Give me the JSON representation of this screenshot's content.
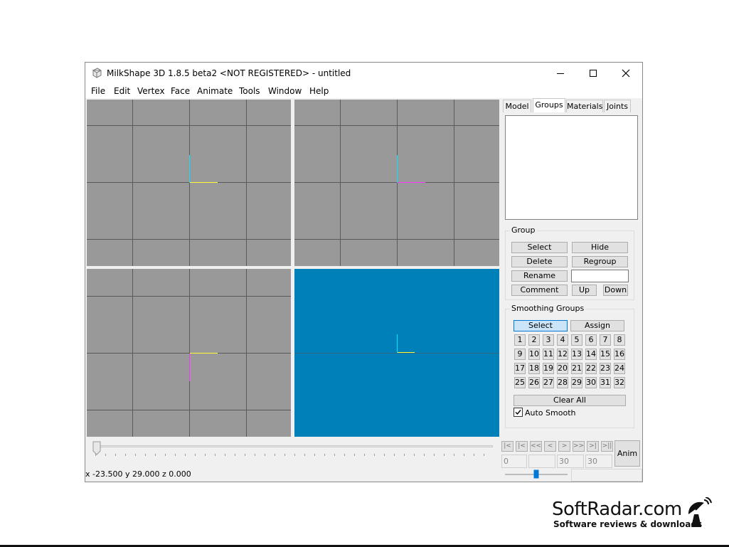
{
  "window": {
    "title": "MilkShape 3D 1.8.5 beta2 <NOT REGISTERED> - untitled"
  },
  "menu": [
    "File",
    "Edit",
    "Vertex",
    "Face",
    "Animate",
    "Tools",
    "Window",
    "Help"
  ],
  "tabs": [
    {
      "label": "Model",
      "active": false
    },
    {
      "label": "Groups",
      "active": true
    },
    {
      "label": "Materials",
      "active": false
    },
    {
      "label": "Joints",
      "active": false
    }
  ],
  "group_box": {
    "label": "Group",
    "select": "Select",
    "hide": "Hide",
    "delete": "Delete",
    "regroup": "Regroup",
    "rename": "Rename",
    "rename_value": "",
    "comment": "Comment",
    "up": "Up",
    "down": "Down"
  },
  "smoothing": {
    "label": "Smoothing Groups",
    "select": "Select",
    "assign": "Assign",
    "numbers": [
      "1",
      "2",
      "3",
      "4",
      "5",
      "6",
      "7",
      "8",
      "9",
      "10",
      "11",
      "12",
      "13",
      "14",
      "15",
      "16",
      "17",
      "18",
      "19",
      "20",
      "21",
      "22",
      "23",
      "24",
      "25",
      "26",
      "27",
      "28",
      "29",
      "30",
      "31",
      "32"
    ],
    "clear_all": "Clear All",
    "auto_smooth_label": "Auto Smooth",
    "auto_smooth_checked": true
  },
  "animation": {
    "nav_buttons": [
      "|<",
      "|<",
      "<<",
      "<",
      ">",
      ">>",
      ">|",
      ">||"
    ],
    "frame_current": "0",
    "frame_blank": "",
    "frame_a": "30",
    "frame_b": "30",
    "anim_label": "Anim"
  },
  "status": {
    "coords": "x -23.500 y 29.000 z 0.000"
  },
  "watermark": {
    "title": "SoftRadar.com",
    "subtitle": "Software reviews & downloads"
  },
  "colors": {
    "viewport_gray": "#999999",
    "viewport_blue": "#0080b8",
    "grid_line": "#5a5a5a",
    "axis_cyan": "#00e5ff",
    "axis_yellow": "#ffff33",
    "axis_magenta": "#ff33ff"
  }
}
